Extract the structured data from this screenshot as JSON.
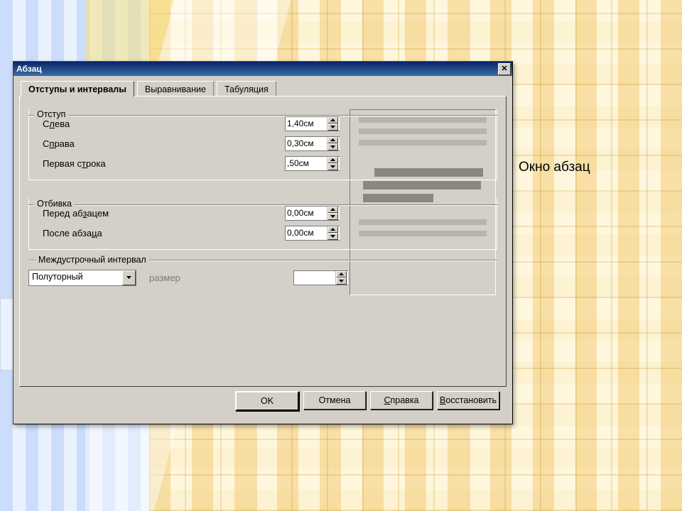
{
  "slide": {
    "caption": "Окно абзац"
  },
  "dialog": {
    "title": "Абзац",
    "tabs": {
      "indents": "Отступы и интервалы",
      "align": "Выравнивание",
      "tabstops": "Табуляция"
    },
    "groups": {
      "indent": {
        "title": "Отступ",
        "left": {
          "label_pre": "С",
          "label_u": "л",
          "label_post": "ева",
          "value": "1,40см"
        },
        "right": {
          "label_pre": "С",
          "label_u": "п",
          "label_post": "рава",
          "value": "0,30см"
        },
        "first": {
          "label_pre": "Первая с",
          "label_u": "т",
          "label_post": "рока",
          "value": ",50см"
        }
      },
      "spacing": {
        "title": "Отбивка",
        "before": {
          "label_pre": "Перед аб",
          "label_u": "з",
          "label_post": "ацем",
          "value": "0,00см"
        },
        "after": {
          "label_pre": "После абза",
          "label_u": "ц",
          "label_post": "а",
          "value": "0,00см"
        }
      },
      "interline": {
        "title": "Междустрочный интервал",
        "combo_value": "Полуторный",
        "size_label": "размер",
        "size_value": ""
      }
    },
    "buttons": {
      "ok": "OK",
      "cancel": "Отмена",
      "help_pre": "",
      "help_u": "С",
      "help_post": "правка",
      "reset_pre": "",
      "reset_u": "В",
      "reset_post": "осстановить"
    }
  }
}
